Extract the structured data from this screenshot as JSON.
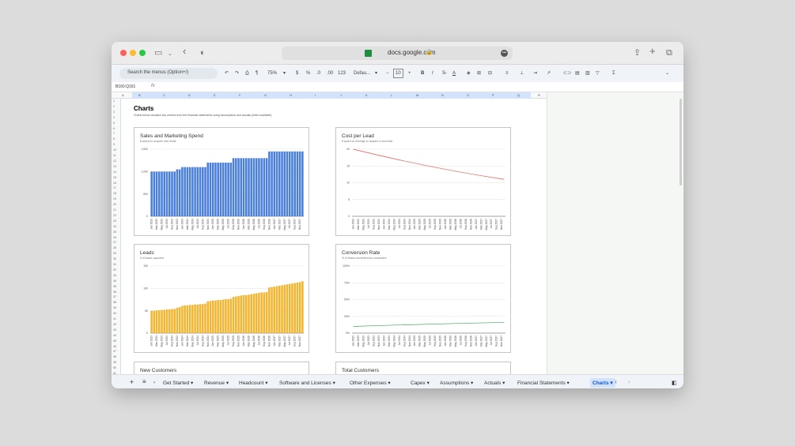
{
  "browser": {
    "url": "docs.google.com"
  },
  "toolbar": {
    "search_placeholder": "Search the menus (Option+/)",
    "zoom": "75%",
    "currency": "$",
    "percent": "%",
    "decimal_decrease": ".0",
    "decimal_increase": ".00",
    "format_123": "123",
    "font": "Defau...",
    "font_size": "10",
    "minus": "−",
    "plus": "+"
  },
  "formula_bar": {
    "name_box": "B160:Q161",
    "fx": "fx"
  },
  "columns": [
    "A",
    "B",
    "C",
    "D",
    "E",
    "F",
    "G",
    "H",
    "I",
    "J",
    "K",
    "L",
    "M",
    "N",
    "O",
    "P",
    "Q",
    "R"
  ],
  "rows": [
    "1",
    "2",
    "3",
    "4",
    "5",
    "6",
    "7",
    "8",
    "9",
    "10",
    "11",
    "12",
    "13",
    "14",
    "15",
    "16",
    "17",
    "18",
    "19",
    "20",
    "21",
    "22",
    "23",
    "24",
    "25",
    "26",
    "27",
    "28",
    "29",
    "30",
    "31",
    "32",
    "33",
    "34",
    "35",
    "36",
    "37",
    "38",
    "39",
    "40",
    "41",
    "42",
    "43",
    "44",
    "45",
    "46",
    "47",
    "48",
    "49",
    "50",
    "51"
  ],
  "sheet": {
    "title": "Charts",
    "subtitle": "Charts below visualize key metrics from the financial statements using assumptions and actuals (when available)"
  },
  "tabs": [
    {
      "label": "Get Started"
    },
    {
      "label": "Revenue"
    },
    {
      "label": "Headcount"
    },
    {
      "label": "Software and Licenses"
    },
    {
      "label": "Other Expenses"
    },
    {
      "label": "Capex"
    },
    {
      "label": "Assumptions"
    },
    {
      "label": "Actuals"
    },
    {
      "label": "Financial Statements"
    },
    {
      "label": "Charts",
      "active": true
    }
  ],
  "chart_data": [
    {
      "type": "bar",
      "title": "Sales and Marketing Spend",
      "subtitle": "$ spend to acquire new leads",
      "color": "#4a7fd9",
      "categories": [
        "Jan 2023",
        "Feb 2023",
        "Mar 2023",
        "Apr 2023",
        "May 2023",
        "Jun 2023",
        "Jul 2023",
        "Aug 2023",
        "Sep 2023",
        "Oct 2023",
        "Nov 2023",
        "Dec 2023",
        "Jan 2024",
        "Feb 2024",
        "Mar 2024",
        "Apr 2024",
        "May 2024",
        "Jun 2024",
        "Jul 2024",
        "Aug 2024",
        "Sep 2024",
        "Oct 2024",
        "Nov 2024",
        "Dec 2024",
        "Jan 2025",
        "Feb 2025",
        "Mar 2025",
        "Apr 2025",
        "May 2025",
        "Jun 2025",
        "Jul 2025",
        "Aug 2025",
        "Sep 2025",
        "Oct 2025",
        "Nov 2025",
        "Dec 2025",
        "Jan 2026",
        "Feb 2026",
        "Mar 2026",
        "Apr 2026",
        "May 2026",
        "Jun 2026",
        "Jul 2026",
        "Aug 2026",
        "Sep 2026",
        "Oct 2026",
        "Nov 2026",
        "Dec 2026",
        "Jan 2027",
        "Feb 2027",
        "Mar 2027",
        "Apr 2027",
        "May 2027",
        "Jun 2027",
        "Jul 2027",
        "Aug 2027",
        "Sep 2027",
        "Oct 2027",
        "Nov 2027",
        "Dec 2027"
      ],
      "values": [
        1000,
        1000,
        1000,
        1000,
        1000,
        1000,
        1000,
        1000,
        1000,
        1000,
        1050,
        1050,
        1100,
        1100,
        1100,
        1100,
        1100,
        1100,
        1100,
        1100,
        1100,
        1100,
        1200,
        1200,
        1200,
        1200,
        1200,
        1200,
        1200,
        1200,
        1200,
        1200,
        1300,
        1300,
        1300,
        1300,
        1300,
        1300,
        1300,
        1300,
        1300,
        1300,
        1300,
        1300,
        1300,
        1300,
        1450,
        1450,
        1450,
        1450,
        1450,
        1450,
        1450,
        1450,
        1450,
        1450,
        1450,
        1450,
        1450,
        1450
      ],
      "xticks": [
        "Jan 2023",
        "Mar 2023",
        "May 2023",
        "Jul 2023",
        "Sep 2023",
        "Nov 2023",
        "Jan 2024",
        "Mar 2024",
        "May 2024",
        "Jul 2024",
        "Sep 2024",
        "Nov 2024",
        "Jan 2025",
        "Mar 2025",
        "May 2025",
        "Jul 2025",
        "Sep 2025",
        "Nov 2025",
        "Jan 2026",
        "Mar 2026",
        "May 2026",
        "Jul 2026",
        "Sep 2026",
        "Nov 2026",
        "Jan 2027",
        "Mar 2027",
        "May 2027",
        "Jul 2027",
        "Sep 2027",
        "Nov 2027"
      ],
      "yticks": [
        "0",
        "500",
        "1,000",
        "1,500"
      ],
      "ylim": [
        0,
        1500
      ]
    },
    {
      "type": "line",
      "title": "Cost per Lead",
      "subtitle": "$ spent on average to acquire a new lead",
      "color": "#e0564a",
      "x": [
        "Jan 2023",
        "Dec 2027"
      ],
      "values": [
        20,
        11
      ],
      "xticks": [
        "Jan 2023",
        "Mar 2023",
        "May 2023",
        "Jul 2023",
        "Sep 2023",
        "Nov 2023",
        "Jan 2024",
        "Mar 2024",
        "May 2024",
        "Jul 2024",
        "Sep 2024",
        "Nov 2024",
        "Jan 2025",
        "Mar 2025",
        "May 2025",
        "Jul 2025",
        "Sep 2025",
        "Nov 2025",
        "Jan 2026",
        "Mar 2026",
        "May 2026",
        "Jul 2026",
        "Sep 2026",
        "Nov 2026",
        "Jan 2027",
        "Mar 2027",
        "May 2027",
        "Jul 2027",
        "Sep 2027",
        "Nov 2027"
      ],
      "yticks": [
        "0",
        "5",
        "10",
        "15",
        "20"
      ],
      "ylim": [
        0,
        20
      ]
    },
    {
      "type": "bar",
      "title": "Leads",
      "subtitle": "# of leads captured",
      "color": "#f2b530",
      "categories": [
        "Jan 2023",
        "Feb 2023",
        "Mar 2023",
        "Apr 2023",
        "May 2023",
        "Jun 2023",
        "Jul 2023",
        "Aug 2023",
        "Sep 2023",
        "Oct 2023",
        "Nov 2023",
        "Dec 2023",
        "Jan 2024",
        "Feb 2024",
        "Mar 2024",
        "Apr 2024",
        "May 2024",
        "Jun 2024",
        "Jul 2024",
        "Aug 2024",
        "Sep 2024",
        "Oct 2024",
        "Nov 2024",
        "Dec 2024",
        "Jan 2025",
        "Feb 2025",
        "Mar 2025",
        "Apr 2025",
        "May 2025",
        "Jun 2025",
        "Jul 2025",
        "Aug 2025",
        "Sep 2025",
        "Oct 2025",
        "Nov 2025",
        "Dec 2025",
        "Jan 2026",
        "Feb 2026",
        "Mar 2026",
        "Apr 2026",
        "May 2026",
        "Jun 2026",
        "Jul 2026",
        "Aug 2026",
        "Sep 2026",
        "Oct 2026",
        "Nov 2026",
        "Dec 2026",
        "Jan 2027",
        "Feb 2027",
        "Mar 2027",
        "Apr 2027",
        "May 2027",
        "Jun 2027",
        "Jul 2027",
        "Aug 2027",
        "Sep 2027",
        "Oct 2027",
        "Nov 2027",
        "Dec 2027"
      ],
      "values": [
        50,
        50,
        51,
        51,
        52,
        52,
        53,
        53,
        54,
        54,
        57,
        58,
        61,
        62,
        62,
        63,
        63,
        64,
        64,
        65,
        65,
        66,
        71,
        72,
        73,
        73,
        74,
        74,
        75,
        76,
        76,
        77,
        81,
        82,
        83,
        84,
        85,
        85,
        86,
        87,
        88,
        89,
        90,
        91,
        91,
        92,
        102,
        103,
        104,
        105,
        106,
        107,
        108,
        109,
        110,
        111,
        112,
        113,
        114,
        116
      ],
      "xticks": [
        "Jan 2023",
        "Mar 2023",
        "May 2023",
        "Jul 2023",
        "Sep 2023",
        "Nov 2023",
        "Jan 2024",
        "Mar 2024",
        "May 2024",
        "Jul 2024",
        "Sep 2024",
        "Nov 2024",
        "Jan 2025",
        "Mar 2025",
        "May 2025",
        "Jul 2025",
        "Sep 2025",
        "Nov 2025",
        "Jan 2026",
        "Mar 2026",
        "May 2026",
        "Jul 2026",
        "Sep 2026",
        "Nov 2026",
        "Jan 2027",
        "Mar 2027",
        "May 2027",
        "Jul 2027",
        "Sep 2027",
        "Nov 2027"
      ],
      "yticks": [
        "0",
        "50",
        "100",
        "150"
      ],
      "ylim": [
        0,
        150
      ]
    },
    {
      "type": "line",
      "title": "Conversion Rate",
      "subtitle": "% of leads converted into customers",
      "color": "#47a35b",
      "x": [
        "Jan 2023",
        "Dec 2027"
      ],
      "values": [
        0.1,
        0.16
      ],
      "xticks": [
        "Jan 2023",
        "Mar 2023",
        "May 2023",
        "Jul 2023",
        "Sep 2023",
        "Nov 2023",
        "Jan 2024",
        "Mar 2024",
        "May 2024",
        "Jul 2024",
        "Sep 2024",
        "Nov 2024",
        "Jan 2025",
        "Mar 2025",
        "May 2025",
        "Jul 2025",
        "Sep 2025",
        "Nov 2025",
        "Jan 2026",
        "Mar 2026",
        "May 2026",
        "Jul 2026",
        "Sep 2026",
        "Nov 2026",
        "Jan 2027",
        "Mar 2027",
        "May 2027",
        "Jul 2027",
        "Sep 2027",
        "Nov 2027"
      ],
      "yticks": [
        "0%",
        "25%",
        "50%",
        "75%",
        "100%"
      ],
      "ylim": [
        0,
        1
      ]
    },
    {
      "type": "bar",
      "title": "New Customers",
      "subtitle": "",
      "color": "#4a7fd9",
      "categories": [],
      "values": []
    },
    {
      "type": "bar",
      "title": "Total Customers",
      "subtitle": "",
      "color": "#4a7fd9",
      "categories": [],
      "values": []
    }
  ]
}
